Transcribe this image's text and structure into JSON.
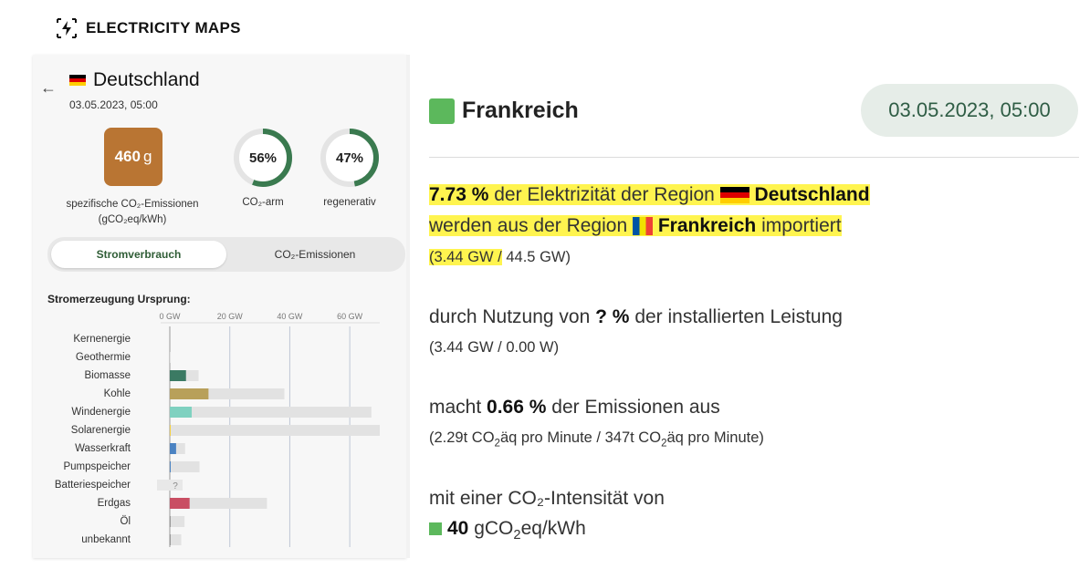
{
  "brand": {
    "name": "ELECTRICITY MAPS",
    "icon": "lightning-bolt-icon"
  },
  "panel": {
    "country": "Deutschland",
    "date": "03.05.2023, 05:00",
    "co2": {
      "value": "460",
      "unit": "g",
      "label_line1": "spezifische CO₂-Emissionen",
      "label_line2": "(gCO₂eq/kWh)",
      "color": "#b97533"
    },
    "low_carbon": {
      "value": "56%",
      "label": "CO₂-arm",
      "fraction": 0.56
    },
    "renewable": {
      "value": "47%",
      "label": "regenerativ",
      "fraction": 0.47
    },
    "toggle": {
      "active": "Stromverbrauch",
      "inactive": "CO₂-Emissionen"
    },
    "chart_title": "Stromerzeugung Ursprung:"
  },
  "chart_data": {
    "type": "bar",
    "orientation": "horizontal",
    "x_ticks": [
      "0 GW",
      "20 GW",
      "40 GW",
      "60 GW"
    ],
    "xlim": [
      0,
      70
    ],
    "categories": [
      "Kernenergie",
      "Geothermie",
      "Biomasse",
      "Kohle",
      "Windenergie",
      "Solarenergie",
      "Wasserkraft",
      "Pumpspeicher",
      "Batteriespeicher",
      "Erdgas",
      "Öl",
      "unbekannt"
    ],
    "series": [
      {
        "values": [
          0,
          0,
          5.4,
          12.9,
          7.3,
          0.2,
          2.1,
          0.3,
          0,
          6.6,
          0.1,
          0.2
        ]
      },
      {
        "values": [
          0,
          0.3,
          9.6,
          38.2,
          67.2,
          70.0,
          5.1,
          9.9,
          0,
          32.4,
          4.9,
          3.8
        ]
      }
    ],
    "colors": [
      "#e6cf3a",
      "#e6cf3a",
      "#3b7a63",
      "#b8a05a",
      "#7fd1c0",
      "#f4d03f",
      "#4b83c2",
      "#4b83c2",
      "#999999",
      "#c94e63",
      "#999999",
      "#999999"
    ],
    "capacity_color": "#e2e2e2",
    "unknown_marker": {
      "category": "Batteriespeicher",
      "text": "?"
    }
  },
  "right": {
    "region": "Frankreich",
    "region_color": "#5cb85c",
    "date": "03.05.2023, 05:00",
    "import": {
      "pct": "7.73 %",
      "text1": "der Elektrizität der Region",
      "de": "Deutschland",
      "text2": "werden aus der Region",
      "fr": "Frankreich",
      "text3": "importiert",
      "detail_hl": "(3.44 GW /",
      "detail_rest": "44.5 GW)"
    },
    "capacity": {
      "text1": "durch Nutzung von",
      "value": "? %",
      "text2": "der installierten Leistung",
      "detail": "(3.44 GW / 0.00 W)"
    },
    "emissions": {
      "text1": "macht",
      "value": "0.66 %",
      "text2": "der Emissionen aus",
      "d1": "(2.29t CO",
      "d2": "äq pro Minute / 347t CO",
      "d3": "äq pro Minute)"
    },
    "intensity": {
      "text": "mit einer CO₂-Intensität von",
      "value": "40",
      "unit_a": "gCO",
      "unit_b": "eq/kWh"
    }
  }
}
